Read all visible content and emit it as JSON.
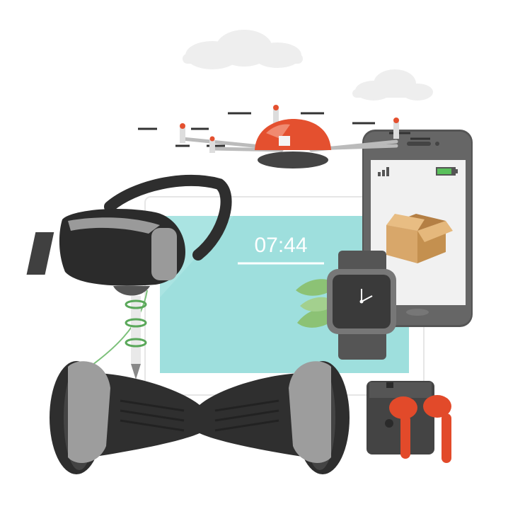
{
  "tablet": {
    "clock_time": "07:44"
  },
  "colors": {
    "tablet_screen": "#9edfdd",
    "tablet_frame": "#ffffff",
    "drone_body": "#e4502f",
    "vr_headset": "#2b2b2b",
    "hoverboard": "#2f2f2f",
    "earbuds": "#e24a2a",
    "phone_frame": "#555555",
    "phone_screen": "#f1f1f1",
    "battery_indicator": "#59c05b",
    "box": "#d8a76a",
    "leaf": "#8cc275",
    "cloud": "#eeeeee"
  },
  "icons": [
    "cloud-icon",
    "quadcopter-drone",
    "smartphone",
    "signal-bars-icon",
    "battery-icon",
    "cardboard-box-icon",
    "tablet",
    "vr-headset",
    "smartwatch",
    "stylus-pen",
    "hoverboard",
    "earbuds-case",
    "earbuds",
    "leaf-icon"
  ]
}
